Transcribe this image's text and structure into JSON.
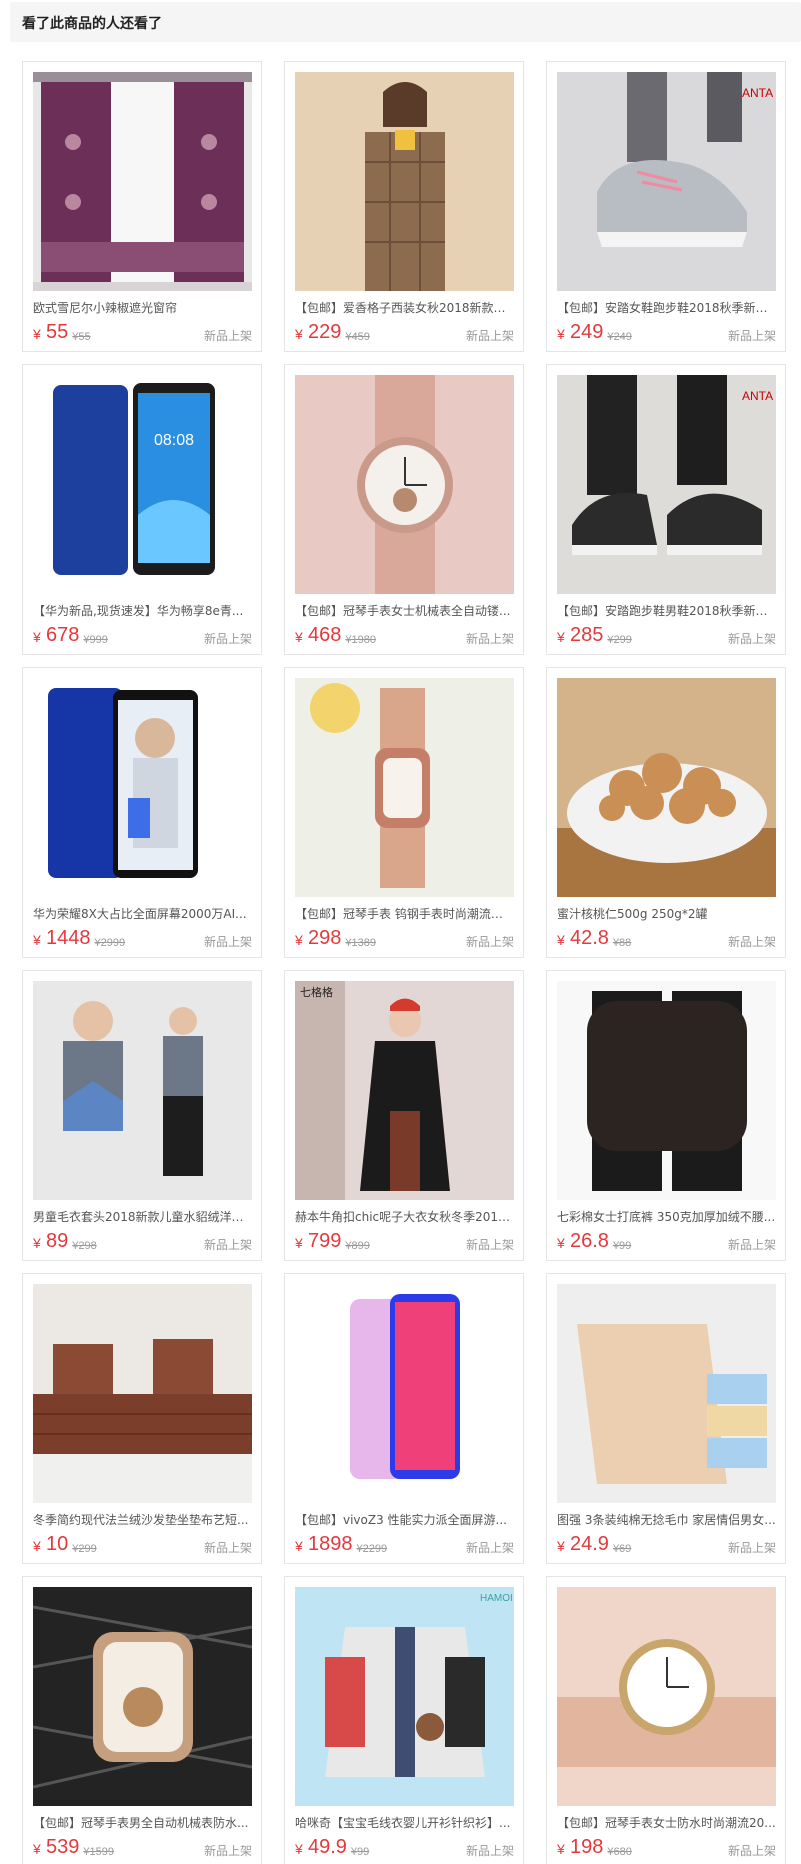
{
  "header": {
    "title": "看了此商品的人还看了"
  },
  "products": [
    {
      "title": "欧式雪尼尔小辣椒遮光窗帘",
      "price": "55",
      "old_price": "¥55",
      "tag": "新品上架",
      "image": "curtain"
    },
    {
      "title": "【包邮】爱香格子西装女秋2018新款英...",
      "price": "229",
      "old_price": "¥459",
      "tag": "新品上架",
      "image": "plaid-blazer"
    },
    {
      "title": "【包邮】安踏女鞋跑步鞋2018秋季新款...",
      "price": "249",
      "old_price": "¥249",
      "tag": "新品上架",
      "image": "pink-sneaker"
    },
    {
      "title": "【华为新品,现货速发】华为畅享8e青...",
      "price": "678",
      "old_price": "¥999",
      "tag": "新品上架",
      "image": "blue-phone"
    },
    {
      "title": "【包邮】冠琴手表女士机械表全自动镂...",
      "price": "468",
      "old_price": "¥1980",
      "tag": "新品上架",
      "image": "rose-watch"
    },
    {
      "title": "【包邮】安踏跑步鞋男鞋2018秋季新款...",
      "price": "285",
      "old_price": "¥299",
      "tag": "新品上架",
      "image": "black-sneaker"
    },
    {
      "title": "华为荣耀8X大占比全面屏幕2000万AI...",
      "price": "1448",
      "old_price": "¥2999",
      "tag": "新品上架",
      "image": "honor-phone"
    },
    {
      "title": "【包邮】冠琴手表 钨钢手表时尚潮流防...",
      "price": "298",
      "old_price": "¥1389",
      "tag": "新品上架",
      "image": "rect-watch"
    },
    {
      "title": "蜜汁核桃仁500g 250g*2罐",
      "price": "42.8",
      "old_price": "¥88",
      "tag": "新品上架",
      "image": "walnuts"
    },
    {
      "title": "男童毛衣套头2018新款儿童水貂绒洋气...",
      "price": "89",
      "old_price": "¥298",
      "tag": "新品上架",
      "image": "boy-sweater"
    },
    {
      "title": "赫本牛角扣chic呢子大衣女秋冬季2018...",
      "price": "799",
      "old_price": "¥899",
      "tag": "新品上架",
      "image": "black-coat"
    },
    {
      "title": "七彩棉女士打底裤 350克加厚加绒不腰...",
      "price": "26.8",
      "old_price": "¥99",
      "tag": "新品上架",
      "image": "leggings"
    },
    {
      "title": "冬季简约现代法兰绒沙发垫坐垫布艺短...",
      "price": "10",
      "old_price": "¥299",
      "tag": "新品上架",
      "image": "sofa"
    },
    {
      "title": "【包邮】vivoZ3 性能实力派全面屏游...",
      "price": "1898",
      "old_price": "¥2299",
      "tag": "新品上架",
      "image": "vivo-phone"
    },
    {
      "title": "图强 3条装纯棉无捻毛巾 家居情侣男女...",
      "price": "24.9",
      "old_price": "¥69",
      "tag": "新品上架",
      "image": "towels"
    },
    {
      "title": "【包邮】冠琴手表男全自动机械表防水...",
      "price": "539",
      "old_price": "¥1599",
      "tag": "新品上架",
      "image": "men-watch"
    },
    {
      "title": "哈咪奇【宝宝毛线衣婴儿开衫针织衫】...",
      "price": "49.9",
      "old_price": "¥99",
      "tag": "新品上架",
      "image": "baby-cardigan"
    },
    {
      "title": "【包邮】冠琴手表女士防水时尚潮流20...",
      "price": "198",
      "old_price": "¥680",
      "tag": "新品上架",
      "image": "gold-watch"
    }
  ],
  "currency": "¥",
  "colors": {
    "price": "#e4393c",
    "header_bg": "#f5f5f5",
    "border": "#e5e5e5"
  }
}
